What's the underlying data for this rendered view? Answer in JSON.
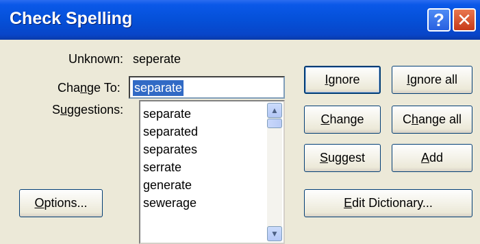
{
  "window": {
    "title": "Check Spelling",
    "help_glyph": "?",
    "close_glyph": "✕"
  },
  "form": {
    "unknown_label": "Unknown:",
    "unknown_value": "seperate",
    "change_to_label_pre": "Cha",
    "change_to_label_u": "n",
    "change_to_label_post": "ge To:",
    "change_to_value": "separate",
    "suggestions_label_pre": "S",
    "suggestions_label_u": "u",
    "suggestions_label_post": "ggestions:"
  },
  "suggestions": [
    "separate",
    "separated",
    "separates",
    "serrate",
    "generate",
    "sewerage"
  ],
  "scrollbar": {
    "up_glyph": "▲",
    "down_glyph": "▼"
  },
  "buttons": {
    "ignore": {
      "u": "I",
      "rest": "gnore"
    },
    "ignore_all": {
      "u": "I",
      "rest": "gnore all"
    },
    "change": {
      "u": "C",
      "rest": "hange"
    },
    "change_all": {
      "pre": "C",
      "u": "h",
      "rest": "ange all"
    },
    "suggest": {
      "u": "S",
      "rest": "uggest"
    },
    "add": {
      "u": "A",
      "rest": "dd"
    },
    "options": {
      "u": "O",
      "rest": "ptions..."
    },
    "edit_dictionary": {
      "u": "E",
      "rest": "dit Dictionary..."
    }
  },
  "colors": {
    "titlebar": "#0550d8",
    "dialog_bg": "#ece9d8",
    "selection": "#316ac5"
  }
}
